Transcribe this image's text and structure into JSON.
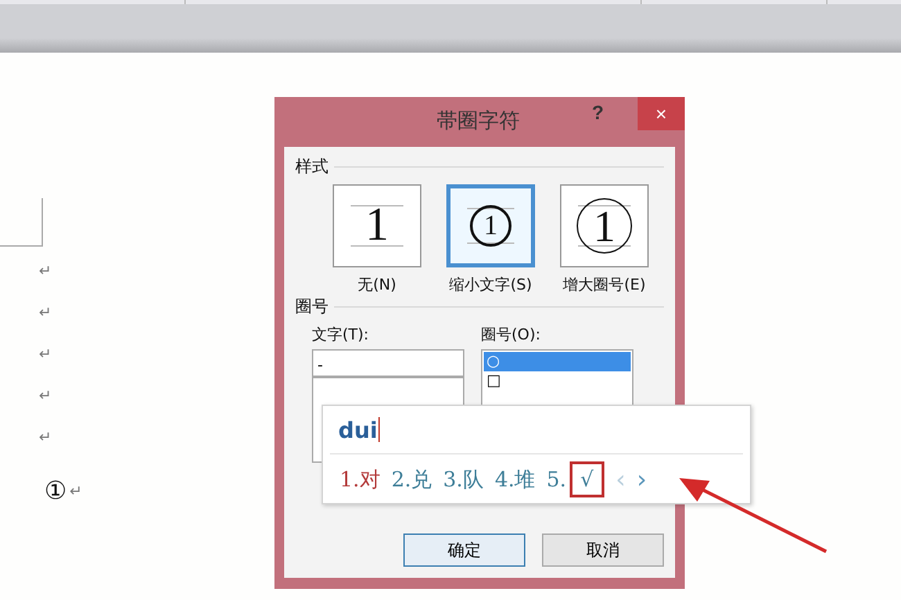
{
  "document": {
    "paragraph_marks": [
      "↵",
      "↵",
      "↵",
      "↵",
      "↵"
    ],
    "last_line": {
      "text": "①",
      "mark": "↵"
    }
  },
  "dialog": {
    "title": "帯圈字符",
    "help": "?",
    "close": "×",
    "style_section": {
      "label": "样式",
      "options": [
        {
          "kind": "none",
          "glyph": "1",
          "label": "无(N)",
          "selected": false
        },
        {
          "kind": "shrink",
          "glyph": "1",
          "label": "缩小文字(S)",
          "selected": true
        },
        {
          "kind": "enlarge",
          "glyph": "1",
          "label": "增大圈号(E)",
          "selected": false
        }
      ]
    },
    "enclosure_section": {
      "label": "圈号",
      "text_label": "文字(T):",
      "text_value": "-",
      "enclosure_label": "圈号(O):",
      "enclosure_items": [
        {
          "symbol": "○",
          "selected": true
        },
        {
          "symbol": "□",
          "selected": false
        }
      ]
    },
    "buttons": [
      {
        "label": "确定",
        "default": true
      },
      {
        "label": "取消",
        "default": false
      }
    ]
  },
  "ime": {
    "input": "dui",
    "candidates": [
      {
        "label": "1.对",
        "selected": true,
        "highlighted": false
      },
      {
        "label": "2.兑",
        "selected": false,
        "highlighted": false
      },
      {
        "label": "3.队",
        "selected": false,
        "highlighted": false
      },
      {
        "label": "4.堆",
        "selected": false,
        "highlighted": false
      },
      {
        "label": "5.",
        "selected": false,
        "highlighted": false
      },
      {
        "label": "√",
        "selected": false,
        "highlighted": true
      }
    ],
    "prev": "‹",
    "next": "›"
  }
}
